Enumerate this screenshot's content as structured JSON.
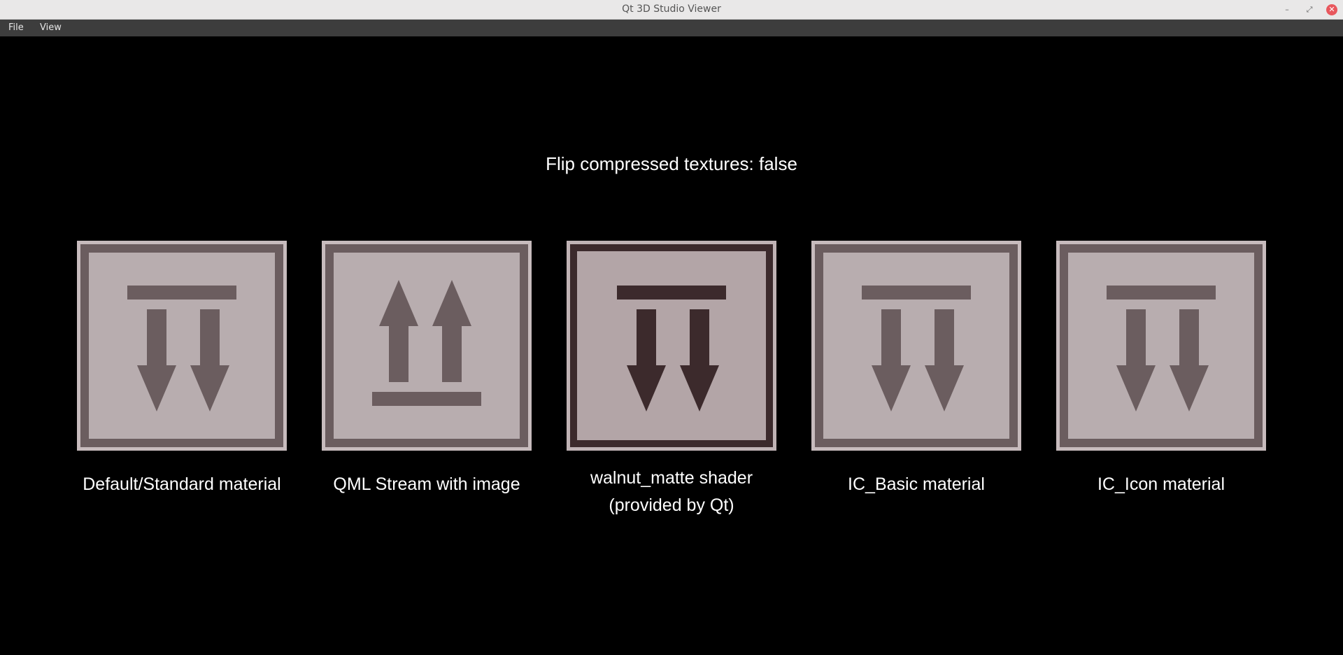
{
  "window": {
    "title": "Qt 3D Studio Viewer",
    "minimize_glyph": "–",
    "maximize_glyph": "⤢",
    "close_glyph": "✕"
  },
  "menu": {
    "file": "File",
    "view": "View"
  },
  "scene": {
    "heading": "Flip compressed textures: false",
    "materials": [
      {
        "label_line1": "Default/Standard material",
        "label_line2": "",
        "icon": "arrows-down-icon"
      },
      {
        "label_line1": "QML Stream with image",
        "label_line2": "",
        "icon": "arrows-up-icon"
      },
      {
        "label_line1": "walnut_matte shader",
        "label_line2": "(provided by Qt)",
        "icon": "arrows-down-icon"
      },
      {
        "label_line1": "IC_Basic material",
        "label_line2": "",
        "icon": "arrows-down-icon"
      },
      {
        "label_line1": "IC_Icon material",
        "label_line2": "",
        "icon": "arrows-down-icon"
      }
    ]
  },
  "colors": {
    "background": "#000000",
    "tile_face": "#b8adaf",
    "tile_border_light": "#c7bbbd",
    "tile_frame": "#6b5d5f",
    "walnut_face": "#b3a5a7",
    "walnut_frame": "#3c2a2c"
  }
}
